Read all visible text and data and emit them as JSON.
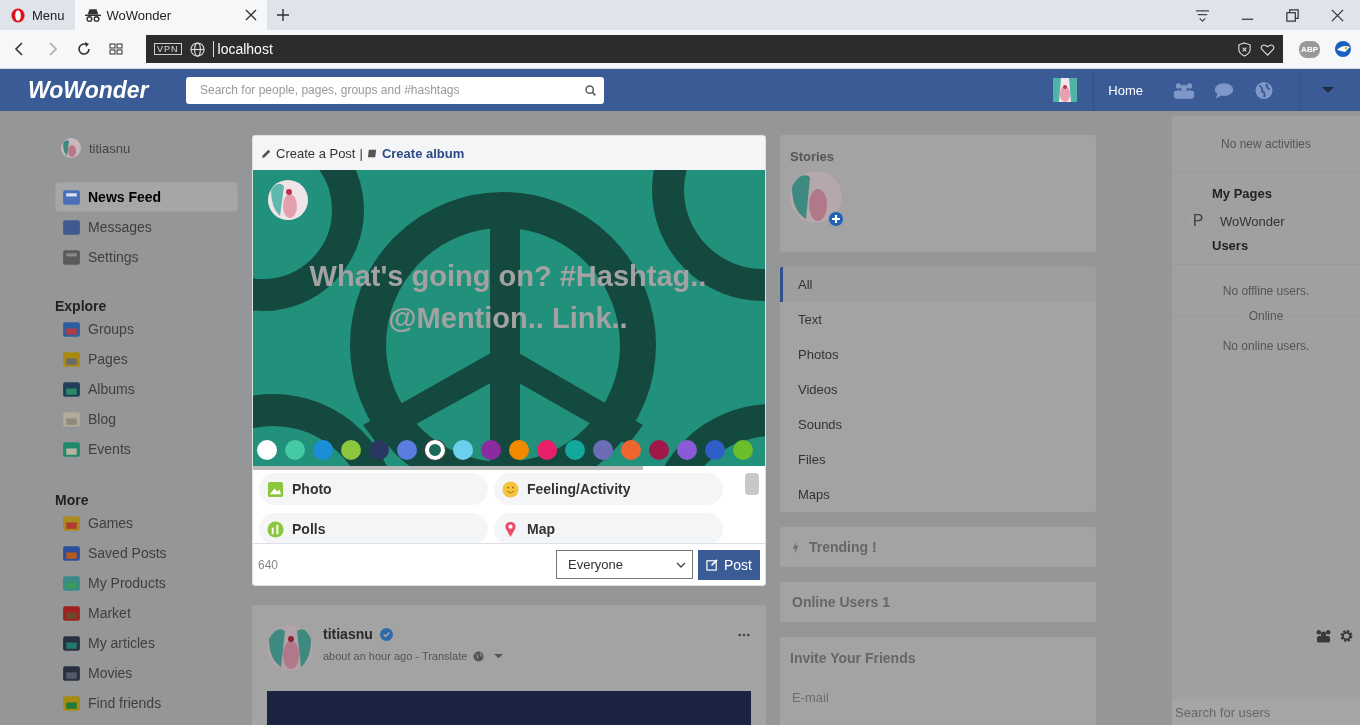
{
  "browser": {
    "tabs": [
      {
        "label": "Menu",
        "kind": "menu",
        "selected": false
      },
      {
        "label": "WoWonder",
        "kind": "page",
        "selected": true
      }
    ],
    "vpn_badge": "VPN",
    "address": "localhost",
    "abp_badge": "ABP"
  },
  "header": {
    "logo": "WoWonder",
    "search_placeholder": "Search for people, pages, groups and #hashtags",
    "nav_label": "Home"
  },
  "sidebar": {
    "user": "titiasnu",
    "main": [
      {
        "label": "News Feed",
        "selected": true
      },
      {
        "label": "Messages",
        "selected": false
      },
      {
        "label": "Settings",
        "selected": false
      }
    ],
    "sections": [
      {
        "title": "Explore",
        "items": [
          {
            "label": "Groups",
            "selected": false
          },
          {
            "label": "Pages",
            "selected": false
          },
          {
            "label": "Albums",
            "selected": false
          },
          {
            "label": "Blog",
            "selected": false
          },
          {
            "label": "Events",
            "selected": false
          }
        ]
      },
      {
        "title": "More",
        "items": [
          {
            "label": "Games",
            "selected": false
          },
          {
            "label": "Saved Posts",
            "selected": false
          },
          {
            "label": "My Products",
            "selected": false
          },
          {
            "label": "Market",
            "selected": false
          },
          {
            "label": "My articles",
            "selected": false
          },
          {
            "label": "Movies",
            "selected": false
          },
          {
            "label": "Find friends",
            "selected": false
          }
        ]
      }
    ]
  },
  "composer": {
    "title": "Create a Post",
    "separator": "|",
    "album_link": "Create album",
    "placeholder": "What's going on? #Hashtag.. @Mention.. Link..",
    "swatches": [
      {
        "color": "#ffffff",
        "selected": false
      },
      {
        "color": "#45c9a5",
        "selected": false
      },
      {
        "color": "#1a8fd8",
        "selected": false
      },
      {
        "color": "#8cc63f",
        "selected": false
      },
      {
        "color": "#2a3760",
        "selected": false
      },
      {
        "color": "#5a7de2",
        "selected": false
      },
      {
        "color": "#1c6b5a",
        "selected": true
      },
      {
        "color": "#6ccff0",
        "selected": false
      },
      {
        "color": "#8a2ca0",
        "selected": false
      },
      {
        "color": "#f28a00",
        "selected": false
      },
      {
        "color": "#e8206a",
        "selected": false
      },
      {
        "color": "#12a89b",
        "selected": false
      },
      {
        "color": "#6d6db5",
        "selected": false
      },
      {
        "color": "#f0652f",
        "selected": false
      },
      {
        "color": "#a0184a",
        "selected": false
      },
      {
        "color": "#8a5bd6",
        "selected": false
      },
      {
        "color": "#2f5ec9",
        "selected": false
      },
      {
        "color": "#6cbd2a",
        "selected": false
      }
    ],
    "actions": [
      "Photo",
      "Feeling/Activity",
      "Polls",
      "Map"
    ],
    "char_count": "640",
    "privacy": "Everyone",
    "post_button": "Post"
  },
  "post": {
    "author": "titiasnu",
    "verified": true,
    "meta": "about an hour ago - Translate"
  },
  "right": {
    "stories_title": "Stories",
    "filters": [
      {
        "label": "All",
        "selected": true
      },
      {
        "label": "Text",
        "selected": false
      },
      {
        "label": "Photos",
        "selected": false
      },
      {
        "label": "Videos",
        "selected": false
      },
      {
        "label": "Sounds",
        "selected": false
      },
      {
        "label": "Files",
        "selected": false
      },
      {
        "label": "Maps",
        "selected": false
      }
    ],
    "trending": "Trending !",
    "online_users": "Online Users 1",
    "invite_title": "Invite Your Friends",
    "email_placeholder": "E-mail"
  },
  "activity": {
    "no_activities": "No new activities",
    "pages_title": "My Pages",
    "pages": [
      {
        "initial": "P",
        "name": "WoWonder"
      }
    ],
    "users_title": "Users",
    "no_offline": "No offline users.",
    "online_label": "Online",
    "no_online": "No online users.",
    "search_placeholder": "Search for users"
  }
}
